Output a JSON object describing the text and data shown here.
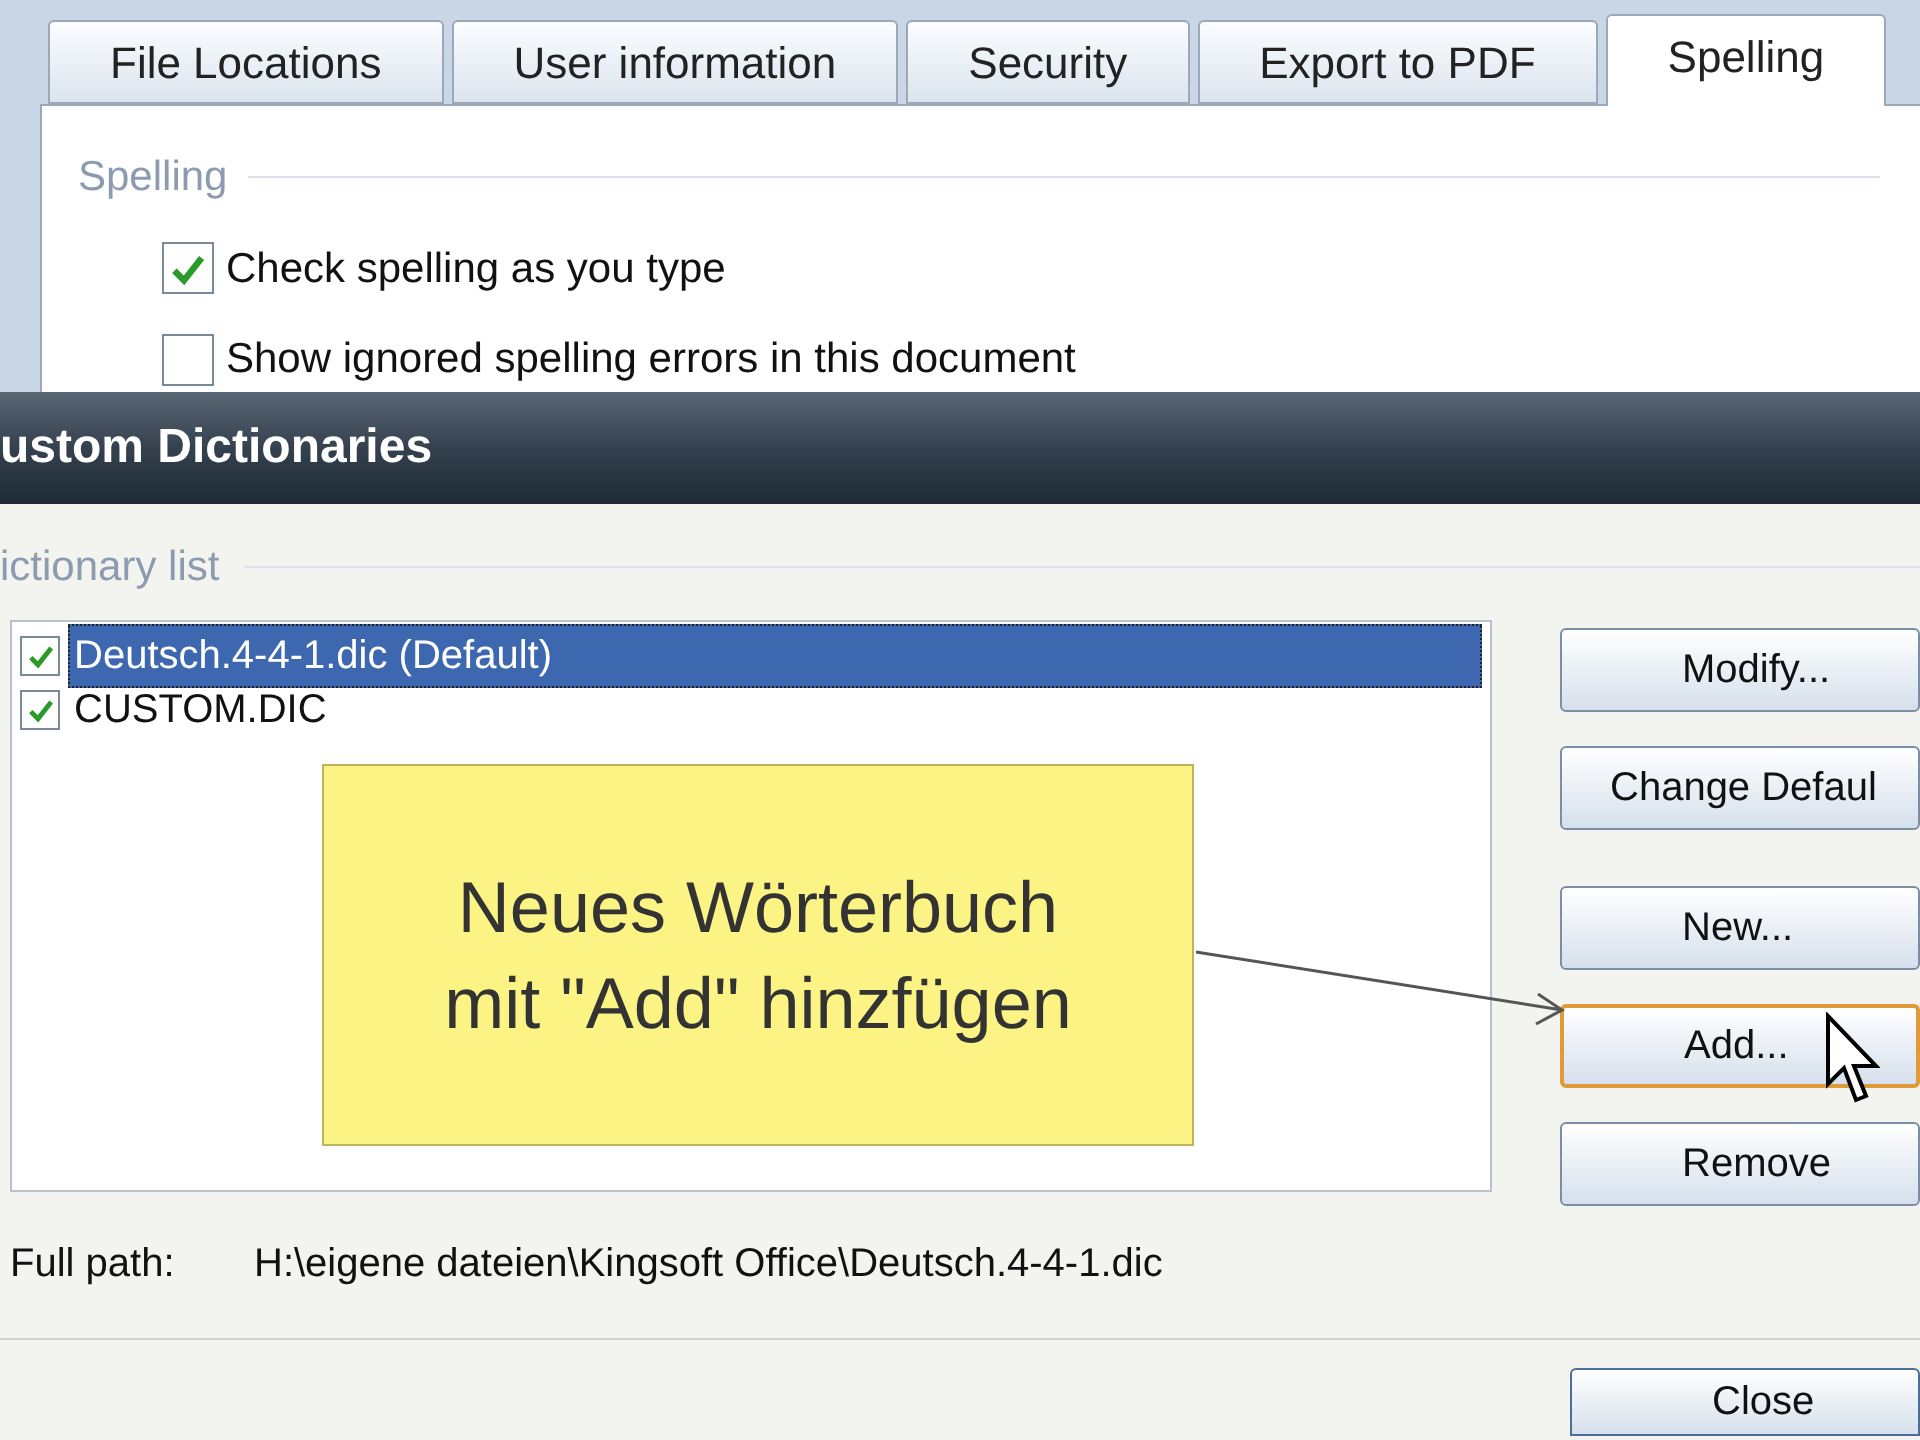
{
  "background_dialog": {
    "tabs": [
      {
        "label": "File Locations",
        "selected": false
      },
      {
        "label": "User information",
        "selected": false
      },
      {
        "label": "Security",
        "selected": false
      },
      {
        "label": "Export to PDF",
        "selected": false
      },
      {
        "label": "Spelling",
        "selected": true
      }
    ],
    "group_label": "Spelling",
    "options": [
      {
        "label": "Check spelling as you type",
        "checked": true
      },
      {
        "label": "Show ignored spelling errors in this document",
        "checked": false
      }
    ]
  },
  "dialog": {
    "title": "ustom Dictionaries",
    "list_label": "ictionary list",
    "dictionaries": [
      {
        "name": "Deutsch.4-4-1.dic (Default)",
        "checked": true,
        "selected": true
      },
      {
        "name": "CUSTOM.DIC",
        "checked": true,
        "selected": false
      }
    ],
    "buttons": [
      {
        "label": "Modify...",
        "hovered": false
      },
      {
        "label": "Change Defaul",
        "hovered": false
      },
      {
        "label": "New...",
        "hovered": false
      },
      {
        "label": "Add...",
        "hovered": true
      },
      {
        "label": "Remove",
        "hovered": false
      }
    ],
    "full_path_label": "Full path:",
    "full_path": "H:\\eigene dateien\\Kingsoft Office\\Deutsch.4-4-1.dic",
    "close_button": "Close"
  },
  "callout": {
    "lines": [
      "Neues Wörterbuch",
      "mit \"Add\" hinzfügen"
    ]
  }
}
